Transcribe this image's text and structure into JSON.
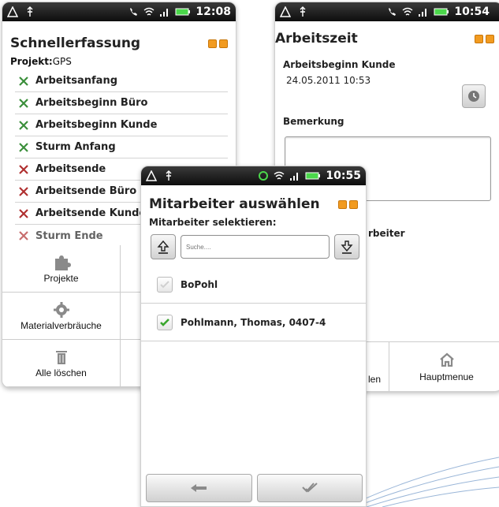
{
  "phone1": {
    "status_time": "12:08",
    "title": "Schnellerfassung",
    "projekt_label": "Projekt:",
    "projekt_value": "GPS",
    "items": [
      {
        "label": "Arbeitsanfang"
      },
      {
        "label": "Arbeitsbeginn Büro"
      },
      {
        "label": "Arbeitsbeginn Kunde"
      },
      {
        "label": "Sturm Anfang"
      },
      {
        "label": "Arbeitsende"
      },
      {
        "label": "Arbeitsende Büro"
      },
      {
        "label": "Arbeitsende Kunde"
      },
      {
        "label": "Sturm Ende"
      }
    ],
    "context_menu": {
      "projekte": "Projekte",
      "materialverbraeuche": "Materialverbräuche",
      "alle_loeschen": "Alle löschen"
    },
    "icons": {
      "tool": "wrench-screwdriver-icon",
      "puzzle": "puzzle-icon",
      "gear": "gear-icon",
      "trash": "trash-icon"
    }
  },
  "phone2": {
    "status_time": "10:54",
    "title": "Arbeitszeit",
    "arbeitsbeginn_label": "Arbeitsbeginn Kunde",
    "arbeitsbeginn_value": "24.05.2011 10:53",
    "bemerkung_label": "Bemerkung",
    "partial_label": "rbeiter",
    "bottom_partial": "len",
    "hauptmenue": "Hauptmenue"
  },
  "phone3": {
    "status_time": "10:55",
    "title": "Mitarbeiter auswählen",
    "subtitle": "Mitarbeiter selektieren:",
    "search_placeholder": "Suche....",
    "employees": [
      {
        "name": "BoPohl",
        "checked": false
      },
      {
        "name": "Pohlmann, Thomas, 0407-4",
        "checked": true
      }
    ]
  },
  "colors": {
    "accent_orange": "#f29b20",
    "check_green": "#3aa62e",
    "statusbar": "#111111"
  }
}
